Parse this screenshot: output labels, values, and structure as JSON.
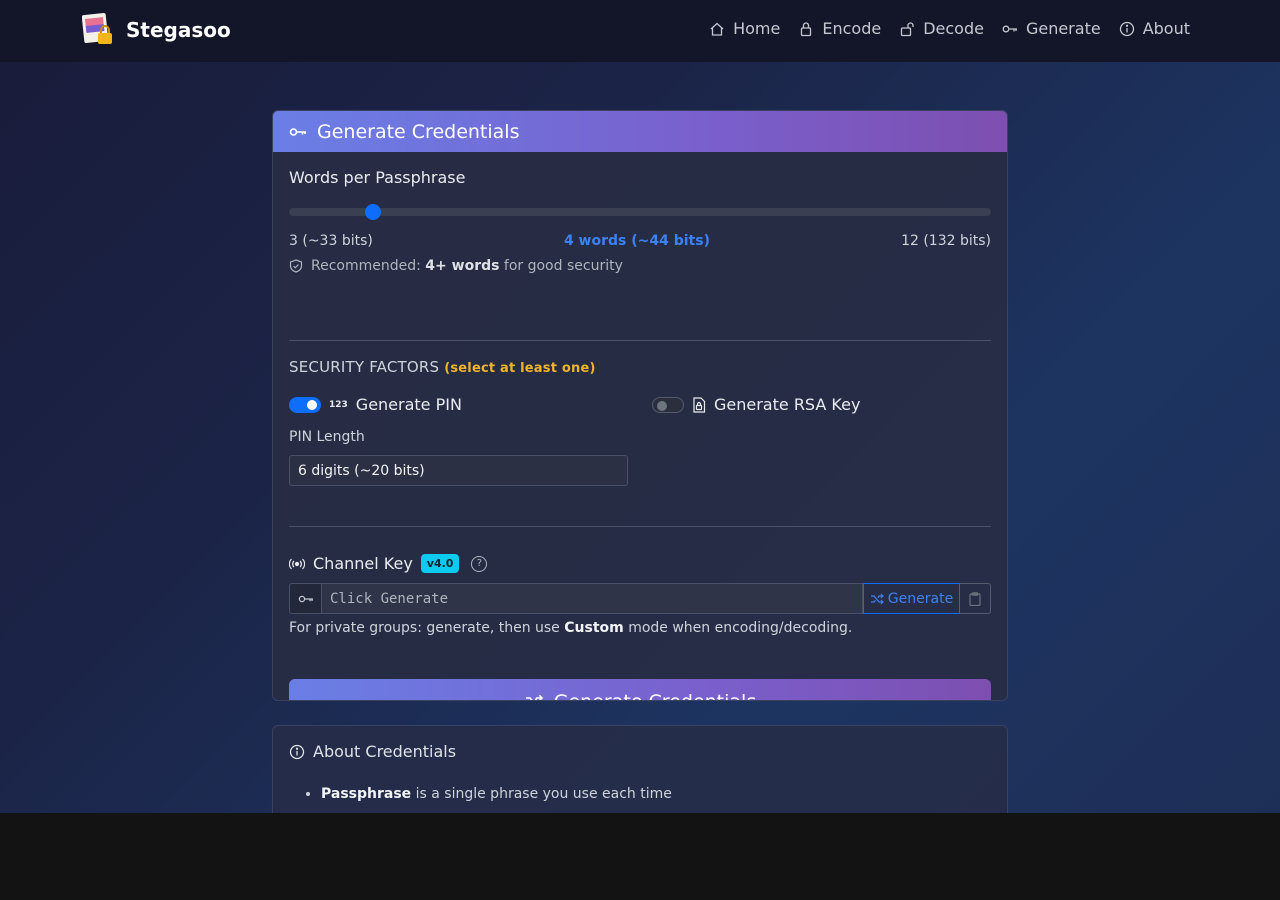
{
  "brand": {
    "name": "Stegasoo"
  },
  "nav": {
    "items": [
      {
        "label": "Home",
        "icon": "home-icon"
      },
      {
        "label": "Encode",
        "icon": "lock-icon"
      },
      {
        "label": "Decode",
        "icon": "unlock-icon"
      },
      {
        "label": "Generate",
        "icon": "key-icon"
      },
      {
        "label": "About",
        "icon": "info-icon"
      }
    ]
  },
  "generate_card": {
    "title": "Generate Credentials",
    "words_label": "Words per Passphrase",
    "slider": {
      "min_label": "3 (~33 bits)",
      "current_label": "4 words (~44 bits)",
      "max_label": "12 (132 bits)",
      "min": 3,
      "max": 12,
      "value": 4
    },
    "recommend_prefix": "Recommended:",
    "recommend_bold": "4+ words",
    "recommend_suffix": "for good security",
    "security_title": "SECURITY FACTORS",
    "security_note": "(select at least one)",
    "pin_toggle": {
      "label": "Generate PIN",
      "icon_text": "123",
      "on": true
    },
    "rsa_toggle": {
      "label": "Generate RSA Key",
      "on": false
    },
    "pin_length_label": "PIN Length",
    "pin_length_value": "6 digits (~20 bits)",
    "channel_key": {
      "label": "Channel Key",
      "badge": "v4.0",
      "help": "?",
      "placeholder": "Click Generate",
      "generate_label": "Generate",
      "help_prefix": "For private groups: generate, then use",
      "help_bold": "Custom",
      "help_suffix": "mode when encoding/decoding."
    },
    "submit_label": "Generate Credentials"
  },
  "about_card": {
    "title": "About Credentials",
    "items": [
      {
        "bold": "Passphrase",
        "text": "is a single phrase you use each time"
      }
    ]
  },
  "colors": {
    "accent": "#0d6efd",
    "header_gradient_start": "#6a7fe6",
    "header_gradient_end": "#7d4fb0",
    "warning": "#f0b429",
    "badge": "#0dcaf0"
  }
}
